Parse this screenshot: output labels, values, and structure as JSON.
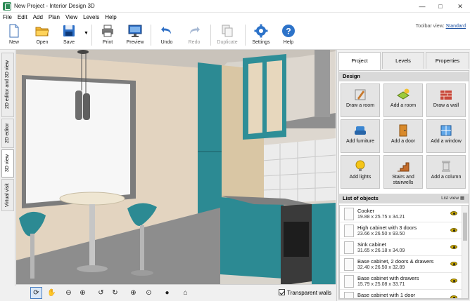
{
  "window": {
    "title": "New Project - Interior Design 3D"
  },
  "menu": [
    "File",
    "Edit",
    "Add",
    "Plan",
    "View",
    "Levels",
    "Help"
  ],
  "toolbar": {
    "new": "New",
    "open": "Open",
    "save": "Save",
    "print": "Print",
    "preview": "Preview",
    "undo": "Undo",
    "redo": "Redo",
    "duplicate": "Duplicate",
    "settings": "Settings",
    "help": "Help",
    "view_label": "Toolbar view:",
    "view_value": "Standard"
  },
  "left_tabs": [
    "2D editor and 3D view",
    "2D editor",
    "3D view",
    "Virtual visit"
  ],
  "bottom": {
    "transparent_walls": "Transparent walls"
  },
  "right_tabs": [
    "Project",
    "Levels",
    "Properties"
  ],
  "design": {
    "header": "Design",
    "buttons": [
      "Draw a room",
      "Add a room",
      "Draw a wall",
      "Add furniture",
      "Add a door",
      "Add a window",
      "Add lights",
      "Stairs and stairwells",
      "Add a column"
    ]
  },
  "objects": {
    "header": "List of objects",
    "list_view": "List view",
    "items": [
      {
        "name": "Cooker",
        "dims": "19.88 x 25.75 x 34.21"
      },
      {
        "name": "High cabinet with 3 doors",
        "dims": "23.66 x 26.50 x 93.50"
      },
      {
        "name": "Sink cabinet",
        "dims": "31.65 x 26.18 x 34.09"
      },
      {
        "name": "Base cabinet, 2 doors & drawers",
        "dims": "32.40 x 26.50 x 32.89"
      },
      {
        "name": "Base cabinet with drawers",
        "dims": "15.79 x 25.08 x 33.71"
      },
      {
        "name": "Base cabinet with 1 door",
        "dims": ""
      }
    ]
  },
  "colors": {
    "accent": "#2f8f9e",
    "cabinet": "#2c8a93",
    "wall": "#e6d9c7"
  }
}
